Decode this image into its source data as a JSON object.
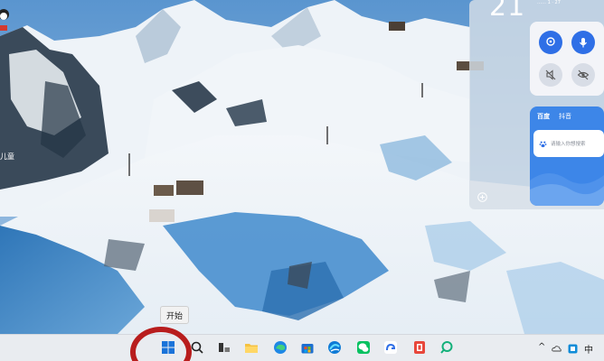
{
  "widgets": {
    "clock": "21",
    "clock_sub": "…… 1  · 27",
    "baidu": {
      "tabs": [
        {
          "label": "百度",
          "active": true
        },
        {
          "label": "抖音",
          "active": false
        }
      ],
      "search_placeholder": "请输入你想搜索"
    }
  },
  "desktop": {
    "partial_label": "儿童"
  },
  "taskbar": {
    "start_tooltip": "开始",
    "icons": [
      "windows-start-icon",
      "search-icon",
      "task-view-icon",
      "file-explorer-icon",
      "edge-browser-icon",
      "microsoft-store-icon",
      "edge-dev-icon",
      "wechat-icon",
      "baidu-netdisk-icon",
      "office-icon",
      "search-app-icon"
    ],
    "tray": {
      "chevron": "^",
      "ime": "中"
    }
  },
  "colors": {
    "accent_blue": "#2f6fe6",
    "baidu_blue": "#3d86e8",
    "annotation_red": "#b81d1d",
    "taskbar": "#e9ecf0"
  }
}
